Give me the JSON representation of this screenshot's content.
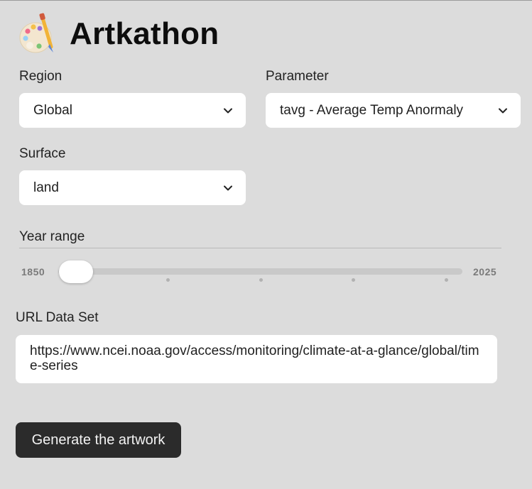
{
  "app": {
    "title": "Artkathon",
    "logo_icon": "artist-palette-icon"
  },
  "region": {
    "label": "Region",
    "selected": "Global"
  },
  "parameter": {
    "label": "Parameter",
    "selected": "tavg - Average Temp Anormaly"
  },
  "surface": {
    "label": "Surface",
    "selected": "land"
  },
  "year_range": {
    "label": "Year range",
    "min": "1850",
    "max": "2025",
    "value": "1850"
  },
  "url_data_set": {
    "label": "URL Data Set",
    "value": "https://www.ncei.noaa.gov/access/monitoring/climate-at-a-glance/global/time-series"
  },
  "generate_button": {
    "label": "Generate the artwork"
  },
  "colors": {
    "background": "#dcdcdc",
    "button": "#2b2b2b",
    "field": "#ffffff"
  }
}
